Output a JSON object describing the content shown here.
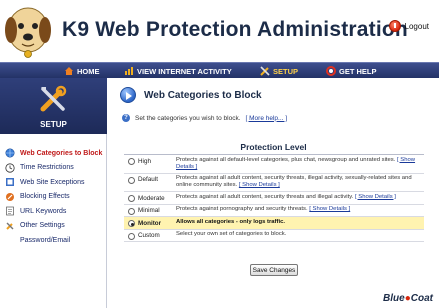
{
  "header": {
    "title": "K9 Web Protection Administration",
    "logout_label": "Logout"
  },
  "nav": {
    "items": [
      {
        "label": "HOME",
        "icon": "home-icon"
      },
      {
        "label": "VIEW INTERNET ACTIVITY",
        "icon": "activity-icon"
      },
      {
        "label": "SETUP",
        "icon": "tools-icon",
        "active": true
      },
      {
        "label": "GET HELP",
        "icon": "help-icon"
      }
    ]
  },
  "sidebar": {
    "section_label": "SETUP",
    "items": [
      {
        "label": "Web Categories to Block",
        "active": true
      },
      {
        "label": "Time Restrictions"
      },
      {
        "label": "Web Site Exceptions"
      },
      {
        "label": "Blocking Effects"
      },
      {
        "label": "URL Keywords"
      },
      {
        "label": "Other Settings"
      },
      {
        "label": "Password/Email"
      }
    ]
  },
  "main": {
    "title": "Web Categories to Block",
    "help_text": "Set the categories you wish to block.",
    "more_help": "[ More help... ]",
    "level_title": "Protection Level",
    "save_label": "Save Changes",
    "levels": [
      {
        "name": "High",
        "desc": "Protects against all default-level categories, plus chat, newsgroup and unrated sites.",
        "details": "[ Show Details ]",
        "checked": false
      },
      {
        "name": "Default",
        "desc": "Protects against all adult content, security threats, illegal activity, sexually-related sites and online community sites.",
        "details": "[ Show Details ]",
        "checked": false
      },
      {
        "name": "Moderate",
        "desc": "Protects against all adult content, security threats and illegal activity.",
        "details": "[ Show Details ]",
        "checked": false
      },
      {
        "name": "Minimal",
        "desc": "Protects against pornography and security threats.",
        "details": "[ Show Details ]",
        "checked": false
      },
      {
        "name": "Monitor",
        "desc": "Allows all categories - only logs traffic.",
        "details": "",
        "checked": true
      },
      {
        "name": "Custom",
        "desc": "Select your own set of categories to block.",
        "details": "",
        "checked": false
      }
    ]
  },
  "brand": {
    "name": "Blue",
    "dot": "●",
    "name2": "Coat"
  }
}
